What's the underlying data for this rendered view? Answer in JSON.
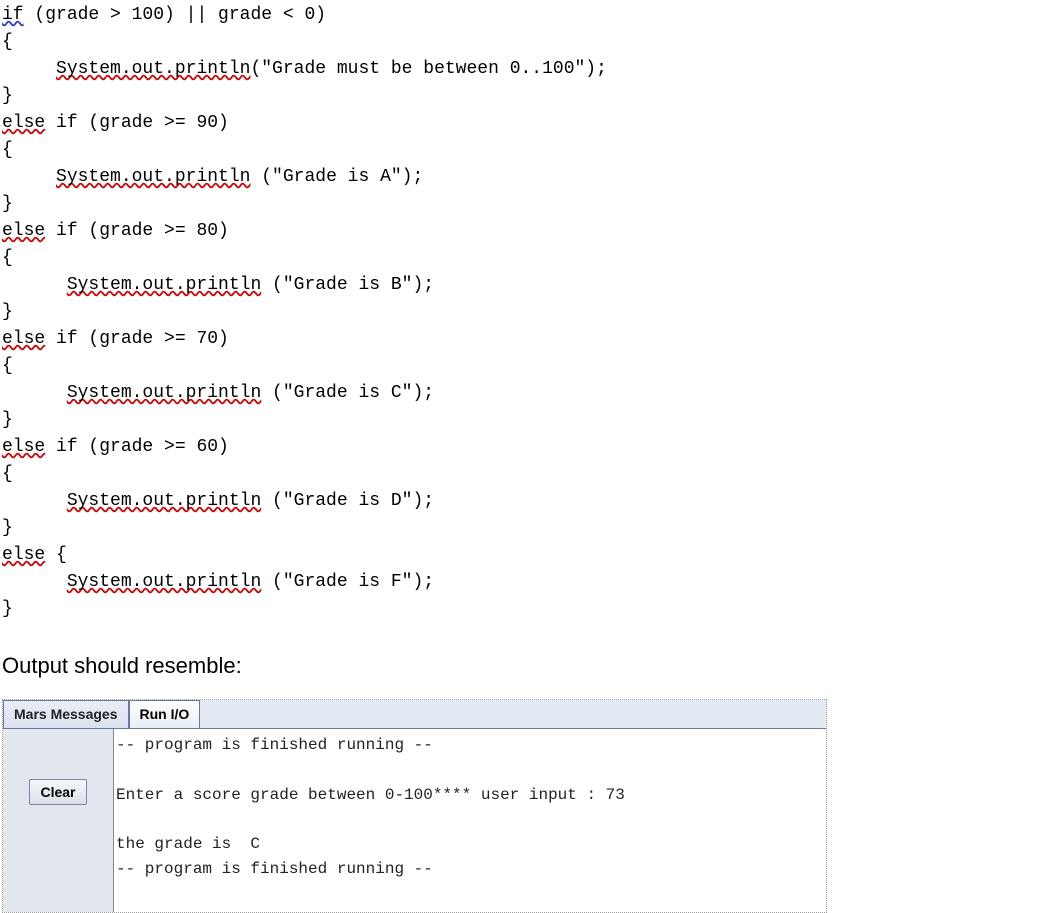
{
  "code": {
    "line1_if": "if",
    "line1_rest": " (grade > 100) || grade < 0)",
    "brace_open": "{",
    "brace_close": "}",
    "sys": "System.out.println",
    "syscall_1_arg": "(\"Grade must be between 0..100\");",
    "syscall_A_arg": " (\"Grade is A\");",
    "syscall_B_arg": " (\"Grade is B\");",
    "syscall_C_arg": " (\"Grade is C\");",
    "syscall_D_arg": " (\"Grade is D\");",
    "syscall_F_arg": " (\"Grade is F\");",
    "else_if_90_else": "else",
    "else_if_90_rest": " if (grade >= 90)",
    "else_if_80_else": "else",
    "else_if_80_rest": " if (grade >= 80)",
    "else_if_70_else": "else",
    "else_if_70_rest": " if (grade >= 70)",
    "else_if_60_else": "else",
    "else_if_60_rest": " if (grade >= 60)",
    "else_final_else": "else",
    "else_final_rest": " {",
    "indent4": "     ",
    "indent6": "      "
  },
  "output_header": "Output should resemble:",
  "tabs": {
    "mars": "Mars Messages",
    "runio": "Run I/O"
  },
  "clear_label": "Clear",
  "console": {
    "line1": "-- program is finished running --",
    "blank": "",
    "line2": "Enter a score grade between 0-100**** user input : 73",
    "line3": "the grade is  C",
    "line4": "-- program is finished running --"
  }
}
